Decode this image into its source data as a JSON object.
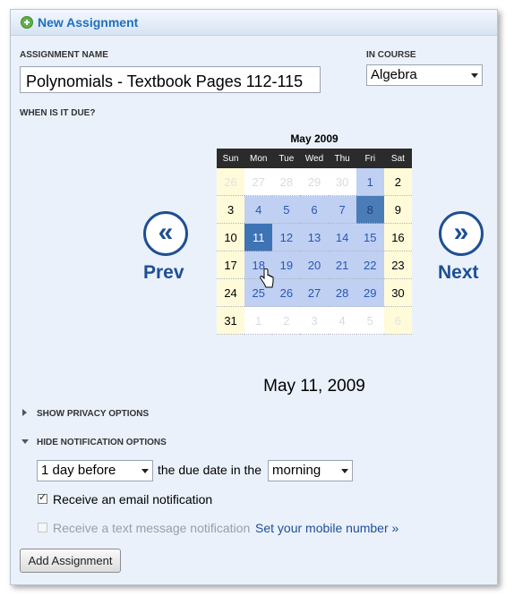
{
  "header": {
    "title": "New Assignment"
  },
  "form": {
    "assignment_name_label": "ASSIGNMENT NAME",
    "assignment_name_value": "Polynomials - Textbook Pages 112-115",
    "course_label": "IN COURSE",
    "course_value": "Algebra",
    "due_label": "WHEN IS IT DUE?"
  },
  "calendar": {
    "month_title": "May 2009",
    "prev_label": "Prev",
    "next_label": "Next",
    "weekdays": [
      "Sun",
      "Mon",
      "Tue",
      "Wed",
      "Thu",
      "Fri",
      "Sat"
    ],
    "weeks": [
      [
        "26",
        "27",
        "28",
        "29",
        "30",
        "1",
        "2"
      ],
      [
        "3",
        "4",
        "5",
        "6",
        "7",
        "8",
        "9"
      ],
      [
        "10",
        "11",
        "12",
        "13",
        "14",
        "15",
        "16"
      ],
      [
        "17",
        "18",
        "19",
        "20",
        "21",
        "22",
        "23"
      ],
      [
        "24",
        "25",
        "26",
        "27",
        "28",
        "29",
        "30"
      ],
      [
        "31",
        "1",
        "2",
        "3",
        "4",
        "5",
        "6"
      ]
    ],
    "selected_date_text": "May 11, 2009"
  },
  "privacy": {
    "toggle_label": "SHOW PRIVACY OPTIONS"
  },
  "notifications": {
    "toggle_label": "HIDE NOTIFICATION OPTIONS",
    "lead_value": "1 day before",
    "middle_text": "the due date in the",
    "time_value": "morning",
    "email_label": "Receive an email notification",
    "email_checked": true,
    "text_label": "Receive a text message notification",
    "text_checked": false,
    "mobile_link": "Set your mobile number »"
  },
  "actions": {
    "add_label": "Add Assignment"
  }
}
